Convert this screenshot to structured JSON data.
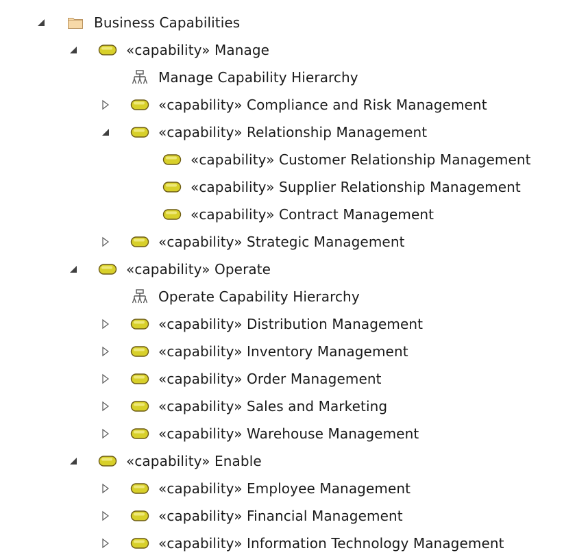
{
  "colors": {
    "folder_fill": "#f7d9a8",
    "folder_stroke": "#b8915c",
    "capability_fill": "#d8d02a",
    "capability_stroke": "#6b5a14",
    "arrow": "#5b5b5b",
    "hierarchy": "#555555"
  },
  "nodes": [
    {
      "level": 0,
      "toggle": "expanded",
      "icon": "folder-icon",
      "label": "Business Capabilities"
    },
    {
      "level": 1,
      "toggle": "expanded",
      "icon": "capability-icon",
      "label": "«capability» Manage"
    },
    {
      "level": 2,
      "toggle": "none",
      "icon": "hierarchy-diagram-icon",
      "label": "Manage Capability Hierarchy"
    },
    {
      "level": 2,
      "toggle": "collapsed",
      "icon": "capability-icon",
      "label": "«capability» Compliance and Risk Management"
    },
    {
      "level": 2,
      "toggle": "expanded",
      "icon": "capability-icon",
      "label": "«capability» Relationship Management"
    },
    {
      "level": 3,
      "toggle": "none",
      "icon": "capability-icon",
      "label": "«capability» Customer Relationship Management"
    },
    {
      "level": 3,
      "toggle": "none",
      "icon": "capability-icon",
      "label": "«capability» Supplier Relationship Management"
    },
    {
      "level": 3,
      "toggle": "none",
      "icon": "capability-icon",
      "label": "«capability» Contract Management"
    },
    {
      "level": 2,
      "toggle": "collapsed",
      "icon": "capability-icon",
      "label": "«capability» Strategic Management"
    },
    {
      "level": 1,
      "toggle": "expanded",
      "icon": "capability-icon",
      "label": "«capability» Operate"
    },
    {
      "level": 2,
      "toggle": "none",
      "icon": "hierarchy-diagram-icon",
      "label": "Operate Capability Hierarchy"
    },
    {
      "level": 2,
      "toggle": "collapsed",
      "icon": "capability-icon",
      "label": "«capability» Distribution Management"
    },
    {
      "level": 2,
      "toggle": "collapsed",
      "icon": "capability-icon",
      "label": "«capability» Inventory Management"
    },
    {
      "level": 2,
      "toggle": "collapsed",
      "icon": "capability-icon",
      "label": "«capability» Order Management"
    },
    {
      "level": 2,
      "toggle": "collapsed",
      "icon": "capability-icon",
      "label": "«capability» Sales and Marketing"
    },
    {
      "level": 2,
      "toggle": "collapsed",
      "icon": "capability-icon",
      "label": "«capability» Warehouse Management"
    },
    {
      "level": 1,
      "toggle": "expanded",
      "icon": "capability-icon",
      "label": "«capability» Enable"
    },
    {
      "level": 2,
      "toggle": "collapsed",
      "icon": "capability-icon",
      "label": "«capability» Employee Management"
    },
    {
      "level": 2,
      "toggle": "collapsed",
      "icon": "capability-icon",
      "label": "«capability» Financial Management"
    },
    {
      "level": 2,
      "toggle": "collapsed",
      "icon": "capability-icon",
      "label": "«capability» Information Technology Management"
    }
  ]
}
